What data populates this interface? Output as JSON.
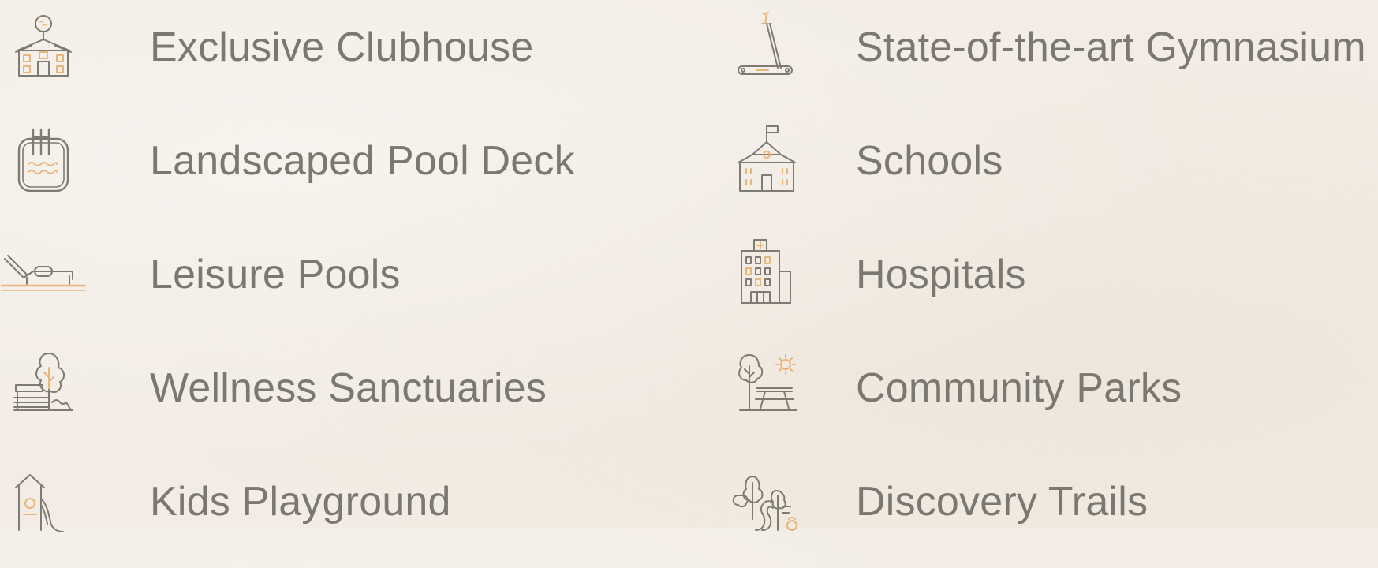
{
  "colors": {
    "background": "#f2ece4",
    "text": "#7a7870",
    "icon_line": "#7d7b72",
    "icon_accent": "#e8b57a"
  },
  "amenities": {
    "left": [
      {
        "label": "Exclusive Clubhouse",
        "icon": "clubhouse-icon"
      },
      {
        "label": "Landscaped Pool Deck",
        "icon": "pool-deck-icon"
      },
      {
        "label": "Leisure Pools",
        "icon": "sun-lounger-icon"
      },
      {
        "label": "Wellness Sanctuaries",
        "icon": "garden-bench-icon"
      },
      {
        "label": "Kids Playground",
        "icon": "playground-slide-icon"
      }
    ],
    "right": [
      {
        "label": "State-of-the-art Gymnasium",
        "icon": "treadmill-icon"
      },
      {
        "label": "Schools",
        "icon": "school-icon"
      },
      {
        "label": "Hospitals",
        "icon": "hospital-icon"
      },
      {
        "label": "Community Parks",
        "icon": "park-picnic-icon"
      },
      {
        "label": "Discovery Trails",
        "icon": "trail-trees-icon"
      }
    ]
  }
}
